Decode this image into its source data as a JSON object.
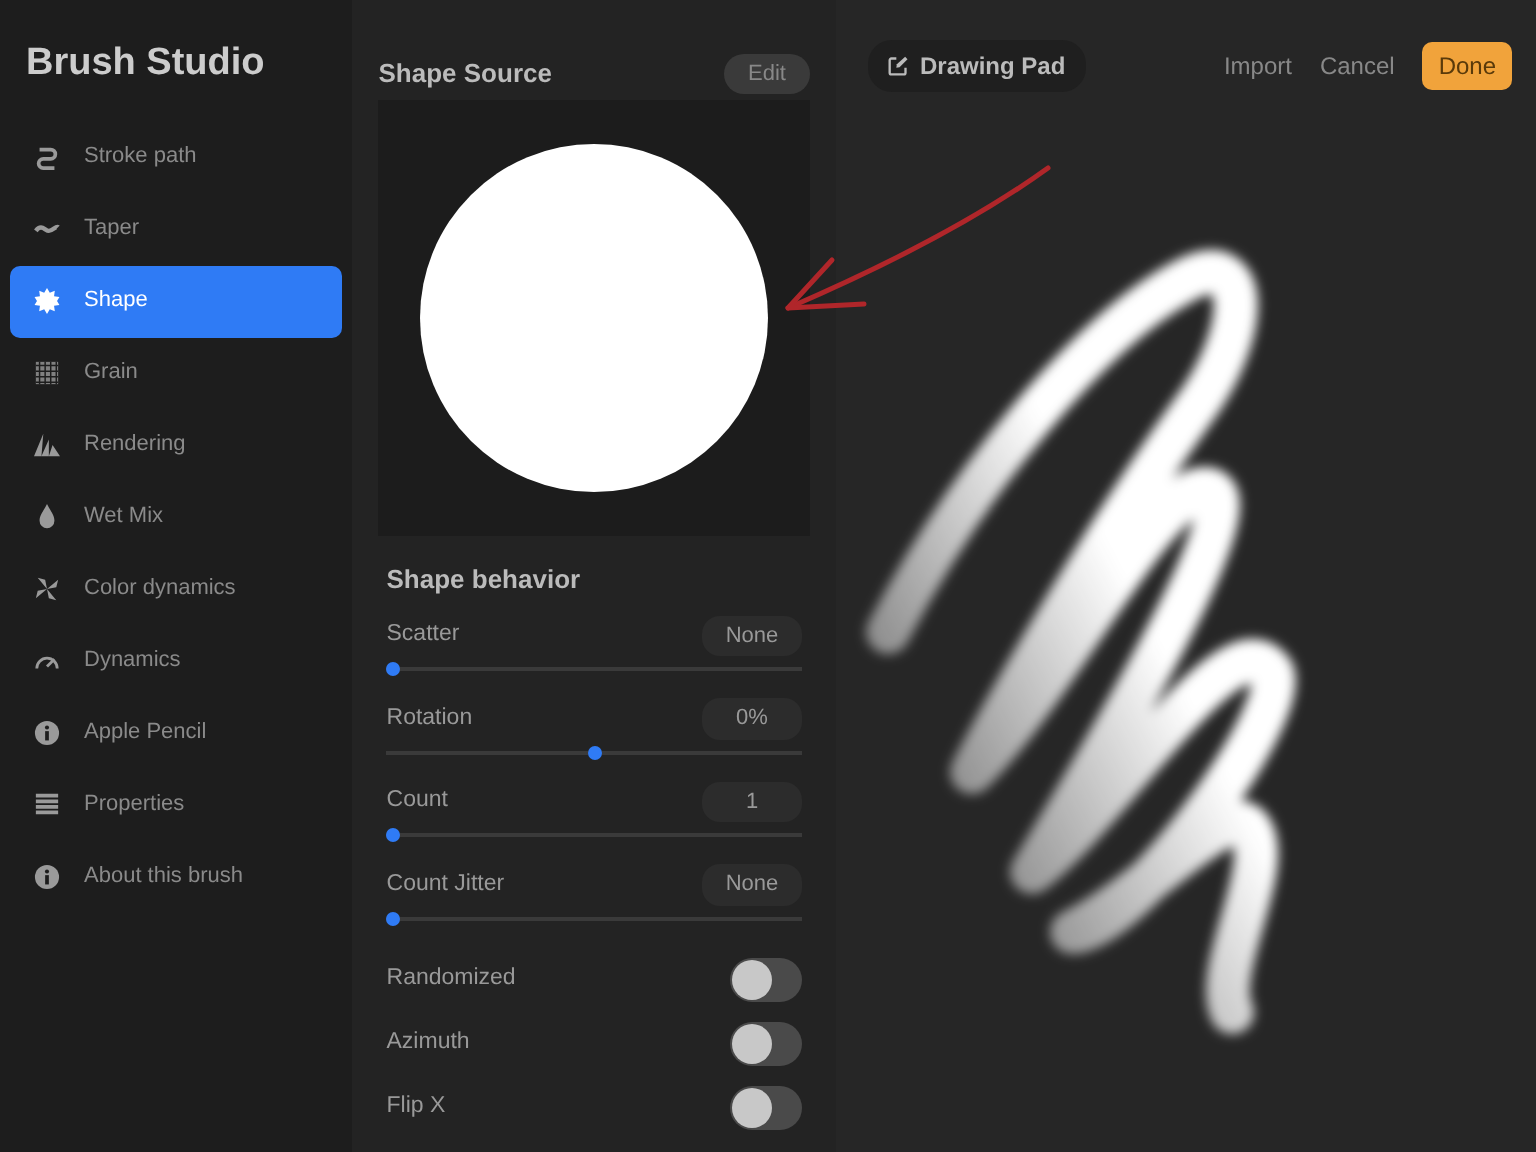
{
  "sidebar": {
    "title": "Brush Studio",
    "items": [
      {
        "label": "Stroke path",
        "selected": false
      },
      {
        "label": "Taper",
        "selected": false
      },
      {
        "label": "Shape",
        "selected": true
      },
      {
        "label": "Grain",
        "selected": false
      },
      {
        "label": "Rendering",
        "selected": false
      },
      {
        "label": "Wet Mix",
        "selected": false
      },
      {
        "label": "Color dynamics",
        "selected": false
      },
      {
        "label": "Dynamics",
        "selected": false
      },
      {
        "label": "Apple Pencil",
        "selected": false
      },
      {
        "label": "Properties",
        "selected": false
      },
      {
        "label": "About this brush",
        "selected": false
      }
    ]
  },
  "shape_source": {
    "title": "Shape Source",
    "edit_button": "Edit"
  },
  "shape_behavior": {
    "title": "Shape behavior",
    "controls": [
      {
        "kind": "slider",
        "label": "Scatter",
        "value": "None",
        "level": 0
      },
      {
        "kind": "slider",
        "label": "Rotation",
        "value": "0%",
        "level": 0.5
      },
      {
        "kind": "slider",
        "label": "Count",
        "value": "1",
        "level": 0
      },
      {
        "kind": "slider",
        "label": "Count Jitter",
        "value": "None",
        "level": 0
      },
      {
        "kind": "toggle",
        "label": "Randomized",
        "on": false
      },
      {
        "kind": "toggle",
        "label": "Azimuth",
        "on": false
      },
      {
        "kind": "toggle",
        "label": "Flip X",
        "on": false
      }
    ]
  },
  "drawing_pad": {
    "title": "Drawing Pad",
    "buttons": [
      "Import",
      "Cancel"
    ],
    "done_button": "Done"
  }
}
